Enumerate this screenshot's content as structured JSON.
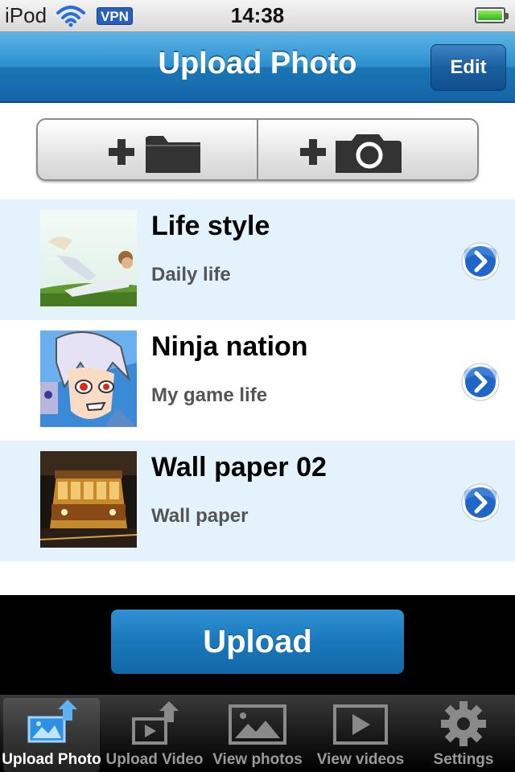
{
  "status_bar": {
    "carrier": "iPod",
    "vpn": "VPN",
    "time": "14:38",
    "battery_level": 1.0
  },
  "nav": {
    "title": "Upload Photo",
    "edit_label": "Edit"
  },
  "add_buttons": [
    {
      "icon": "add-folder-icon"
    },
    {
      "icon": "add-camera-icon"
    }
  ],
  "list": {
    "items": [
      {
        "title": "Life style",
        "subtitle": "Daily life",
        "thumb": "person-lying-on-grass"
      },
      {
        "title": "Ninja nation",
        "subtitle": "My game life",
        "thumb": "anime-character"
      },
      {
        "title": "Wall paper 02",
        "subtitle": "Wall paper",
        "thumb": "tram-at-night"
      }
    ]
  },
  "upload_label": "Upload",
  "tabs": [
    {
      "label": "Upload Photo",
      "icon": "upload-photo-icon",
      "active": true
    },
    {
      "label": "Upload Video",
      "icon": "upload-video-icon",
      "active": false
    },
    {
      "label": "View photos",
      "icon": "view-photos-icon",
      "active": false
    },
    {
      "label": "View videos",
      "icon": "view-videos-icon",
      "active": false
    },
    {
      "label": "Settings",
      "icon": "settings-icon",
      "active": false
    }
  ],
  "colors": {
    "nav_blue": "#1a76b6",
    "row_alt": "#e4f3fb",
    "upload_blue": "#1a78ba",
    "disclosure_blue": "#1f66c8"
  }
}
